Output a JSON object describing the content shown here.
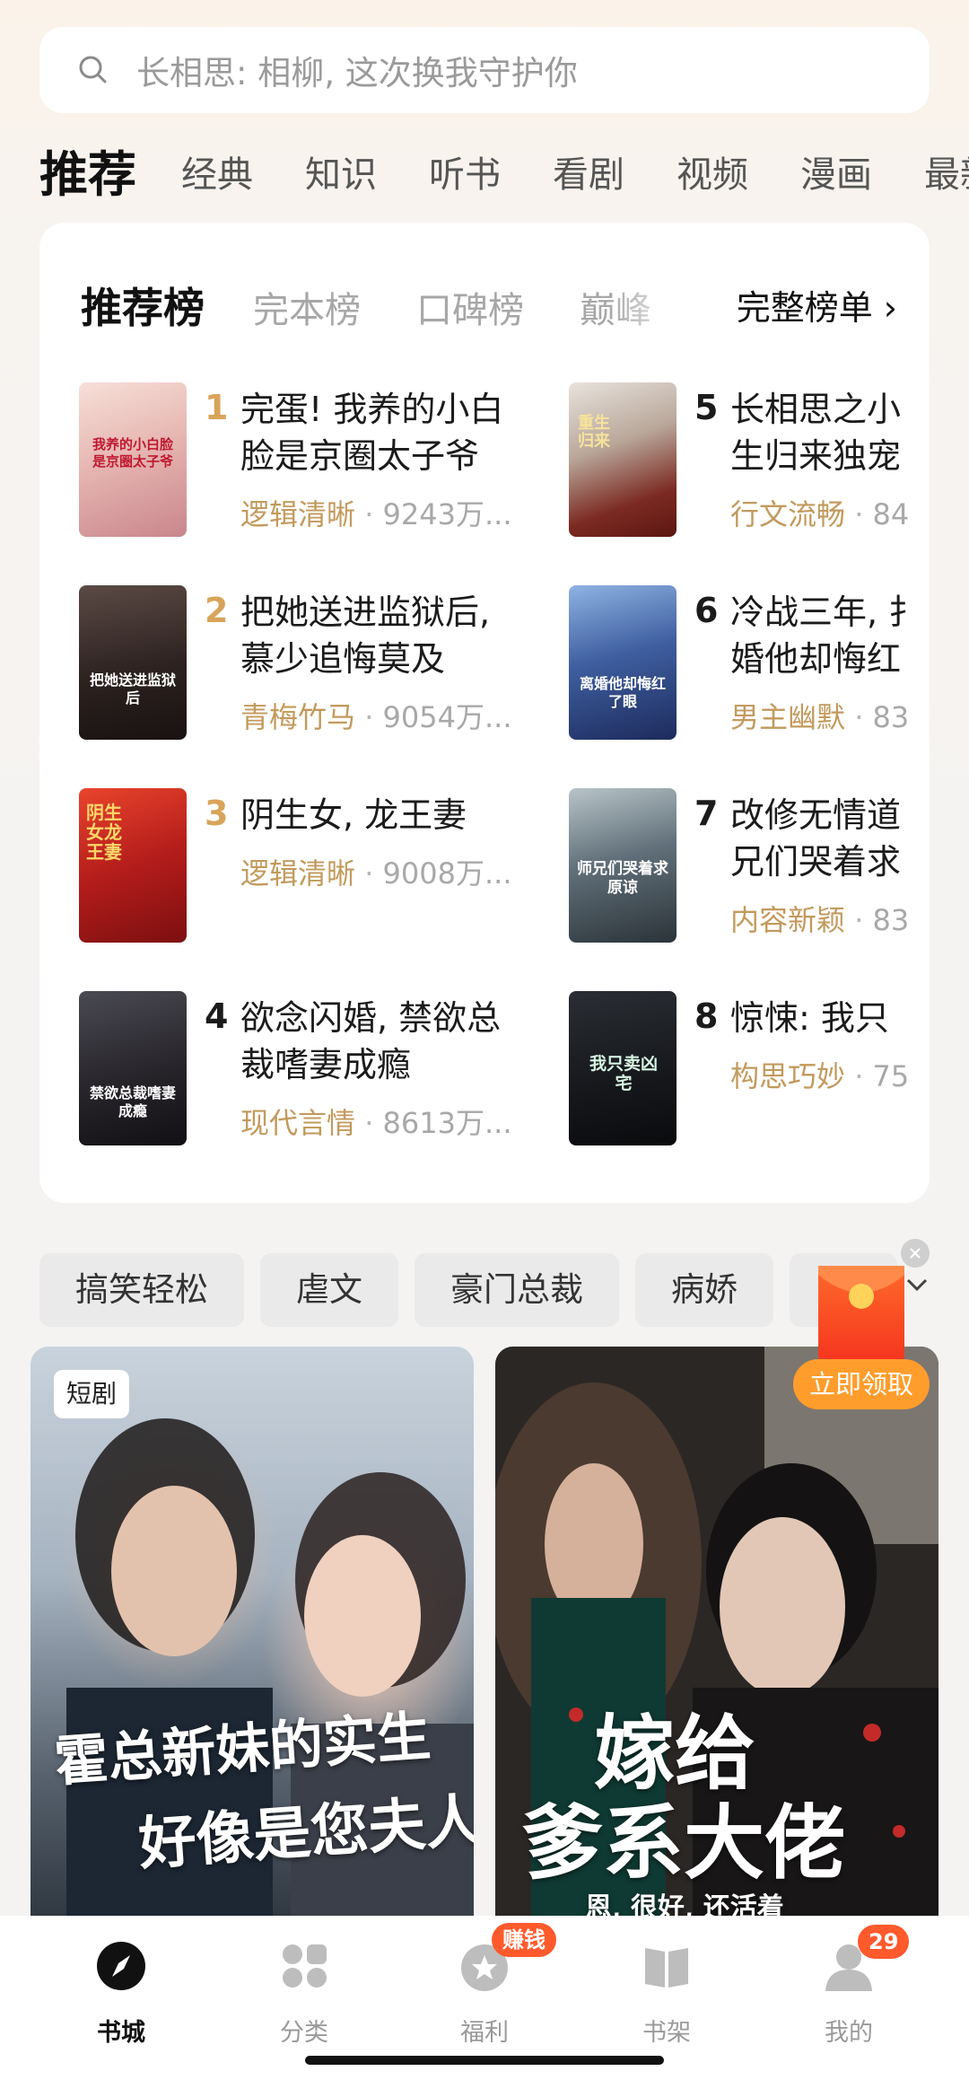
{
  "search": {
    "placeholder": "长相思: 相柳, 这次换我守护你"
  },
  "channels": [
    "推荐",
    "经典",
    "知识",
    "听书",
    "看剧",
    "视频",
    "漫画",
    "最新"
  ],
  "rank_tabs": [
    "推荐榜",
    "完本榜",
    "口碑榜",
    "巅峰"
  ],
  "rank_full_label": "完整榜单 ›",
  "rank_items": [
    {
      "num": "1",
      "line1": "完蛋! 我养的小白",
      "line2": "脸是京圈太子爷",
      "tag": "逻辑清晰",
      "heat": "9243万...",
      "num_color": "#d8a45a",
      "cover_text": "我养的小白脸是京圈太子爷"
    },
    {
      "num": "2",
      "line1": "把她送进监狱后,",
      "line2": "慕少追悔莫及",
      "tag": "青梅竹马",
      "heat": "9054万...",
      "num_color": "#d8a45a",
      "cover_text": "把她送进监狱后"
    },
    {
      "num": "3",
      "line1": "阴生女, 龙王妻",
      "line2": "",
      "tag": "逻辑清晰",
      "heat": "9008万...",
      "num_color": "#d8a45a",
      "cover_text": "阴生女龙王妻"
    },
    {
      "num": "4",
      "line1": "欲念闪婚, 禁欲总",
      "line2": "裁嗜妻成瘾",
      "tag": "现代言情",
      "heat": "8613万...",
      "num_color": "#1b1b1b",
      "cover_text": "禁欲总裁嗜妻成瘾"
    },
    {
      "num": "5",
      "line1": "长相思之小",
      "line2": "生归来独宠",
      "tag": "行文流畅",
      "heat": "84",
      "num_color": "#1b1b1b",
      "cover_text": "重生归来"
    },
    {
      "num": "6",
      "line1": "冷战三年, 扌",
      "line2": "婚他却悔红",
      "tag": "男主幽默",
      "heat": "83",
      "num_color": "#1b1b1b",
      "cover_text": "离婚他却悔红了眼"
    },
    {
      "num": "7",
      "line1": "改修无情道",
      "line2": "兄们哭着求",
      "tag": "内容新颖",
      "heat": "83",
      "num_color": "#1b1b1b",
      "cover_text": "师兄们哭着求原谅"
    },
    {
      "num": "8",
      "line1": "惊悚: 我只",
      "line2": "",
      "tag": "构思巧妙",
      "heat": "75",
      "num_color": "#1b1b1b",
      "cover_text": "我只卖凶宅"
    }
  ],
  "chips": [
    "搞笑轻松",
    "虐文",
    "豪门总裁",
    "病娇"
  ],
  "red_packet": {
    "claim": "立即领取"
  },
  "feed": [
    {
      "badge": "短剧",
      "title_line1": "霍总新妹的实生",
      "title_line2": "好像是您夫人"
    },
    {
      "title_line1": "嫁给",
      "title_line2": "爹系大佬",
      "subtitle": "恩, 很好, 还活着"
    }
  ],
  "nav": [
    {
      "label": "书城",
      "active": true,
      "icon": "compass-icon"
    },
    {
      "label": "分类",
      "active": false,
      "icon": "grid-icon"
    },
    {
      "label": "福利",
      "active": false,
      "icon": "coin-icon",
      "badge": "赚钱"
    },
    {
      "label": "书架",
      "active": false,
      "icon": "book-icon"
    },
    {
      "label": "我的",
      "active": false,
      "icon": "user-icon",
      "badge": "29"
    }
  ],
  "colors": {
    "accent": "#c29a5c",
    "orange": "#ff9d2c",
    "red": "#ff5a2c"
  }
}
